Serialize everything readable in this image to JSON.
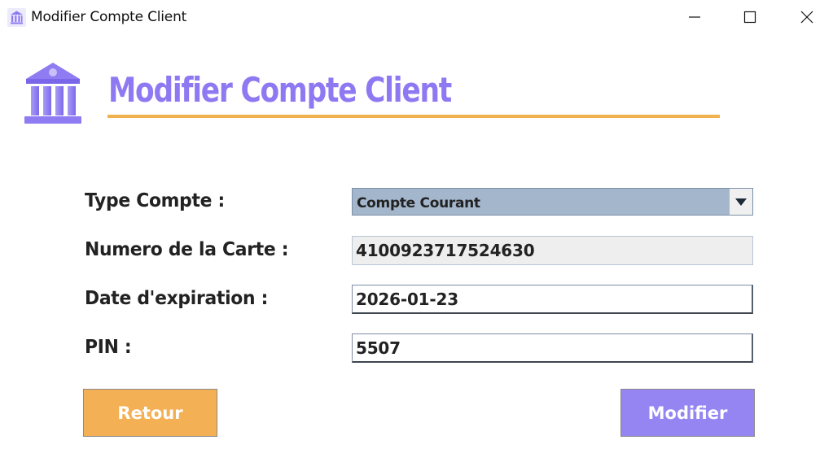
{
  "window": {
    "title": "Modifier Compte Client",
    "controls": [
      "minimize-icon",
      "maximize-icon",
      "close-icon"
    ]
  },
  "header": {
    "logo_icon": "bank-icon",
    "title": "Modifier Compte Client"
  },
  "form": {
    "type_compte": {
      "label": "Type Compte :",
      "value": "Compte Courant"
    },
    "numero_carte": {
      "label": "Numero de la Carte :",
      "value": "4100923717524630",
      "readonly": true
    },
    "date_expiration": {
      "label": "Date d'expiration :",
      "value": "2026-01-23"
    },
    "pin": {
      "label": "PIN :",
      "value": "5507"
    }
  },
  "buttons": {
    "back_label": "Retour",
    "submit_label": "Modifier"
  },
  "colors": {
    "accent_purple": "#8f79f2",
    "accent_orange": "#f0b24f",
    "button_orange": "#f4b055",
    "button_purple": "#9485f2",
    "select_bg": "#a4b6cc"
  }
}
